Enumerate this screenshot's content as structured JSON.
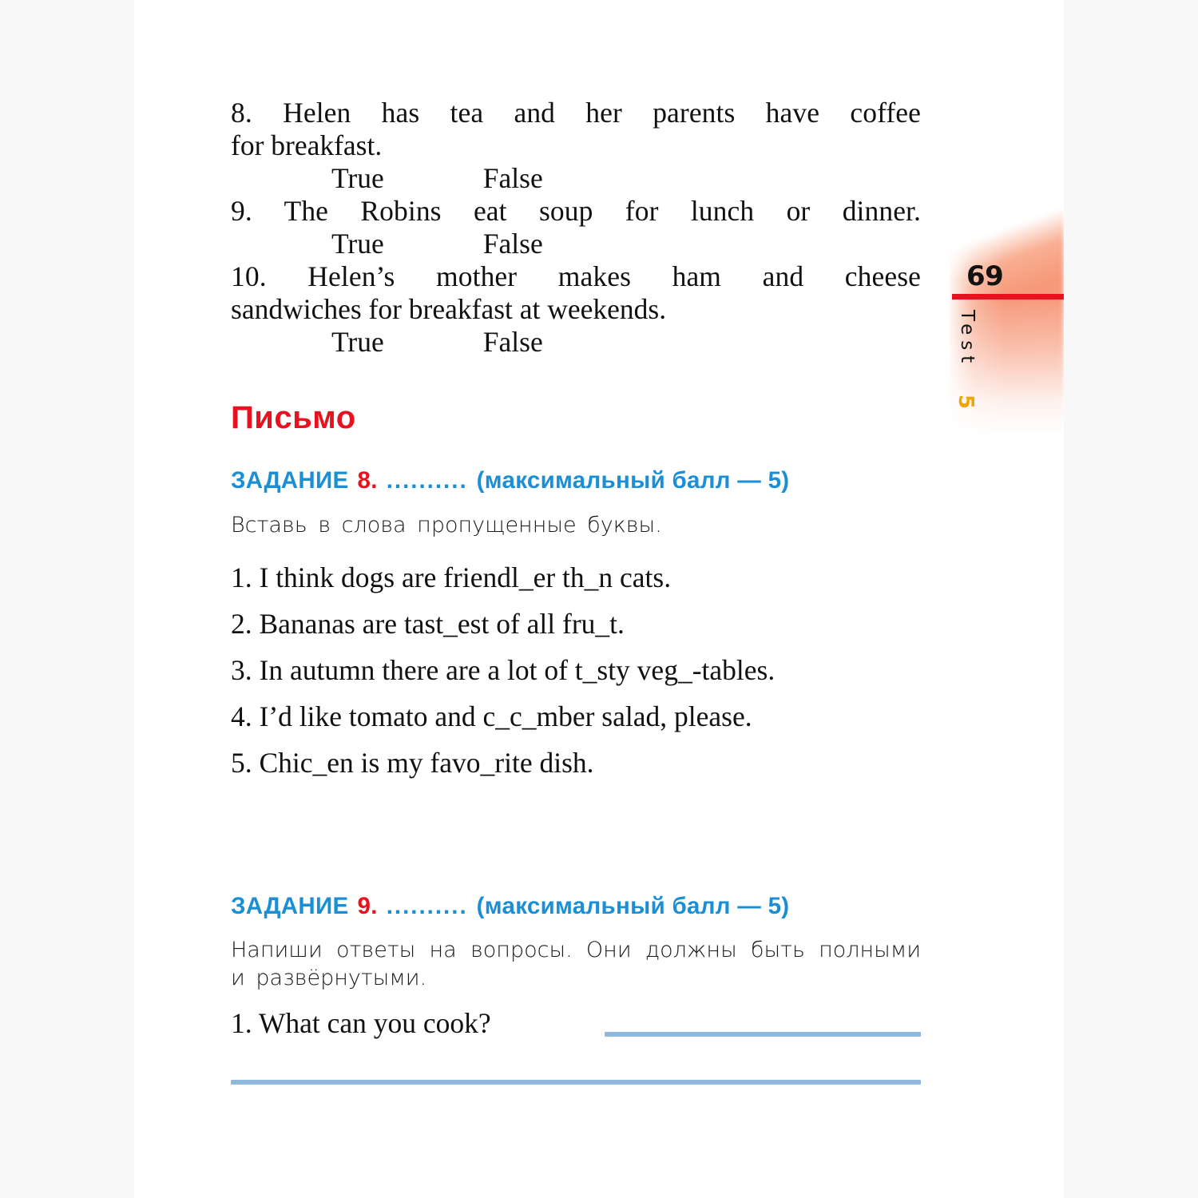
{
  "page": {
    "number": "69",
    "tab_label": "Test",
    "tab_test_number": "5",
    "colors": {
      "heading_red": "#e8121e",
      "task_blue": "#1b8fd6",
      "rule_blue": "#8fb8dd",
      "tab_peach": "#f69676",
      "tab_number_orange": "#f0a500",
      "page_white": "#ffffff",
      "surround_gray": "#f8f8f8"
    }
  },
  "true_false": {
    "options": {
      "true_label": "True",
      "false_label": "False"
    },
    "items": [
      {
        "number": "8.",
        "text": "Helen has tea and her parents have coffee for breakfast."
      },
      {
        "number": "9.",
        "text": "The Robins eat soup for lunch or dinner."
      },
      {
        "number": "10.",
        "text": "Helen’s mother makes ham and cheese sandwiches for breakfast at weekends."
      }
    ],
    "line_8a": "8. Helen has tea and her parents have coffee",
    "line_8b": "for breakfast.",
    "line_9": "9. The Robins eat soup for lunch or dinner.",
    "line_10a": "10. Helen’s mother makes ham and cheese",
    "line_10b": "sandwiches for breakfast at weekends."
  },
  "writing_section": {
    "heading": "Письмо"
  },
  "task8": {
    "label": "ЗАДАНИЕ",
    "number": "8.",
    "dots": "..........",
    "score": "(максимальный  балл  —  5)",
    "instruction": "Вставь в слова пропущенные буквы.",
    "items": [
      "1. I think dogs are friendl_er th_n cats.",
      "2. Bananas are tast_est of all fru_t.",
      "3. In autumn there are a lot of t_sty veg_-tables.",
      "4. I’d like tomato and c_c_mber salad, please.",
      "5. Chic_en is my favo_rite dish."
    ]
  },
  "task9": {
    "label": "ЗАДАНИЕ",
    "number": "9.",
    "dots": "..........",
    "score": "(максимальный  балл  —  5)",
    "instruction": "Напиши ответы на вопросы. Они должны быть полными и развёрнутыми.",
    "question_1": "1. What can you cook?"
  }
}
